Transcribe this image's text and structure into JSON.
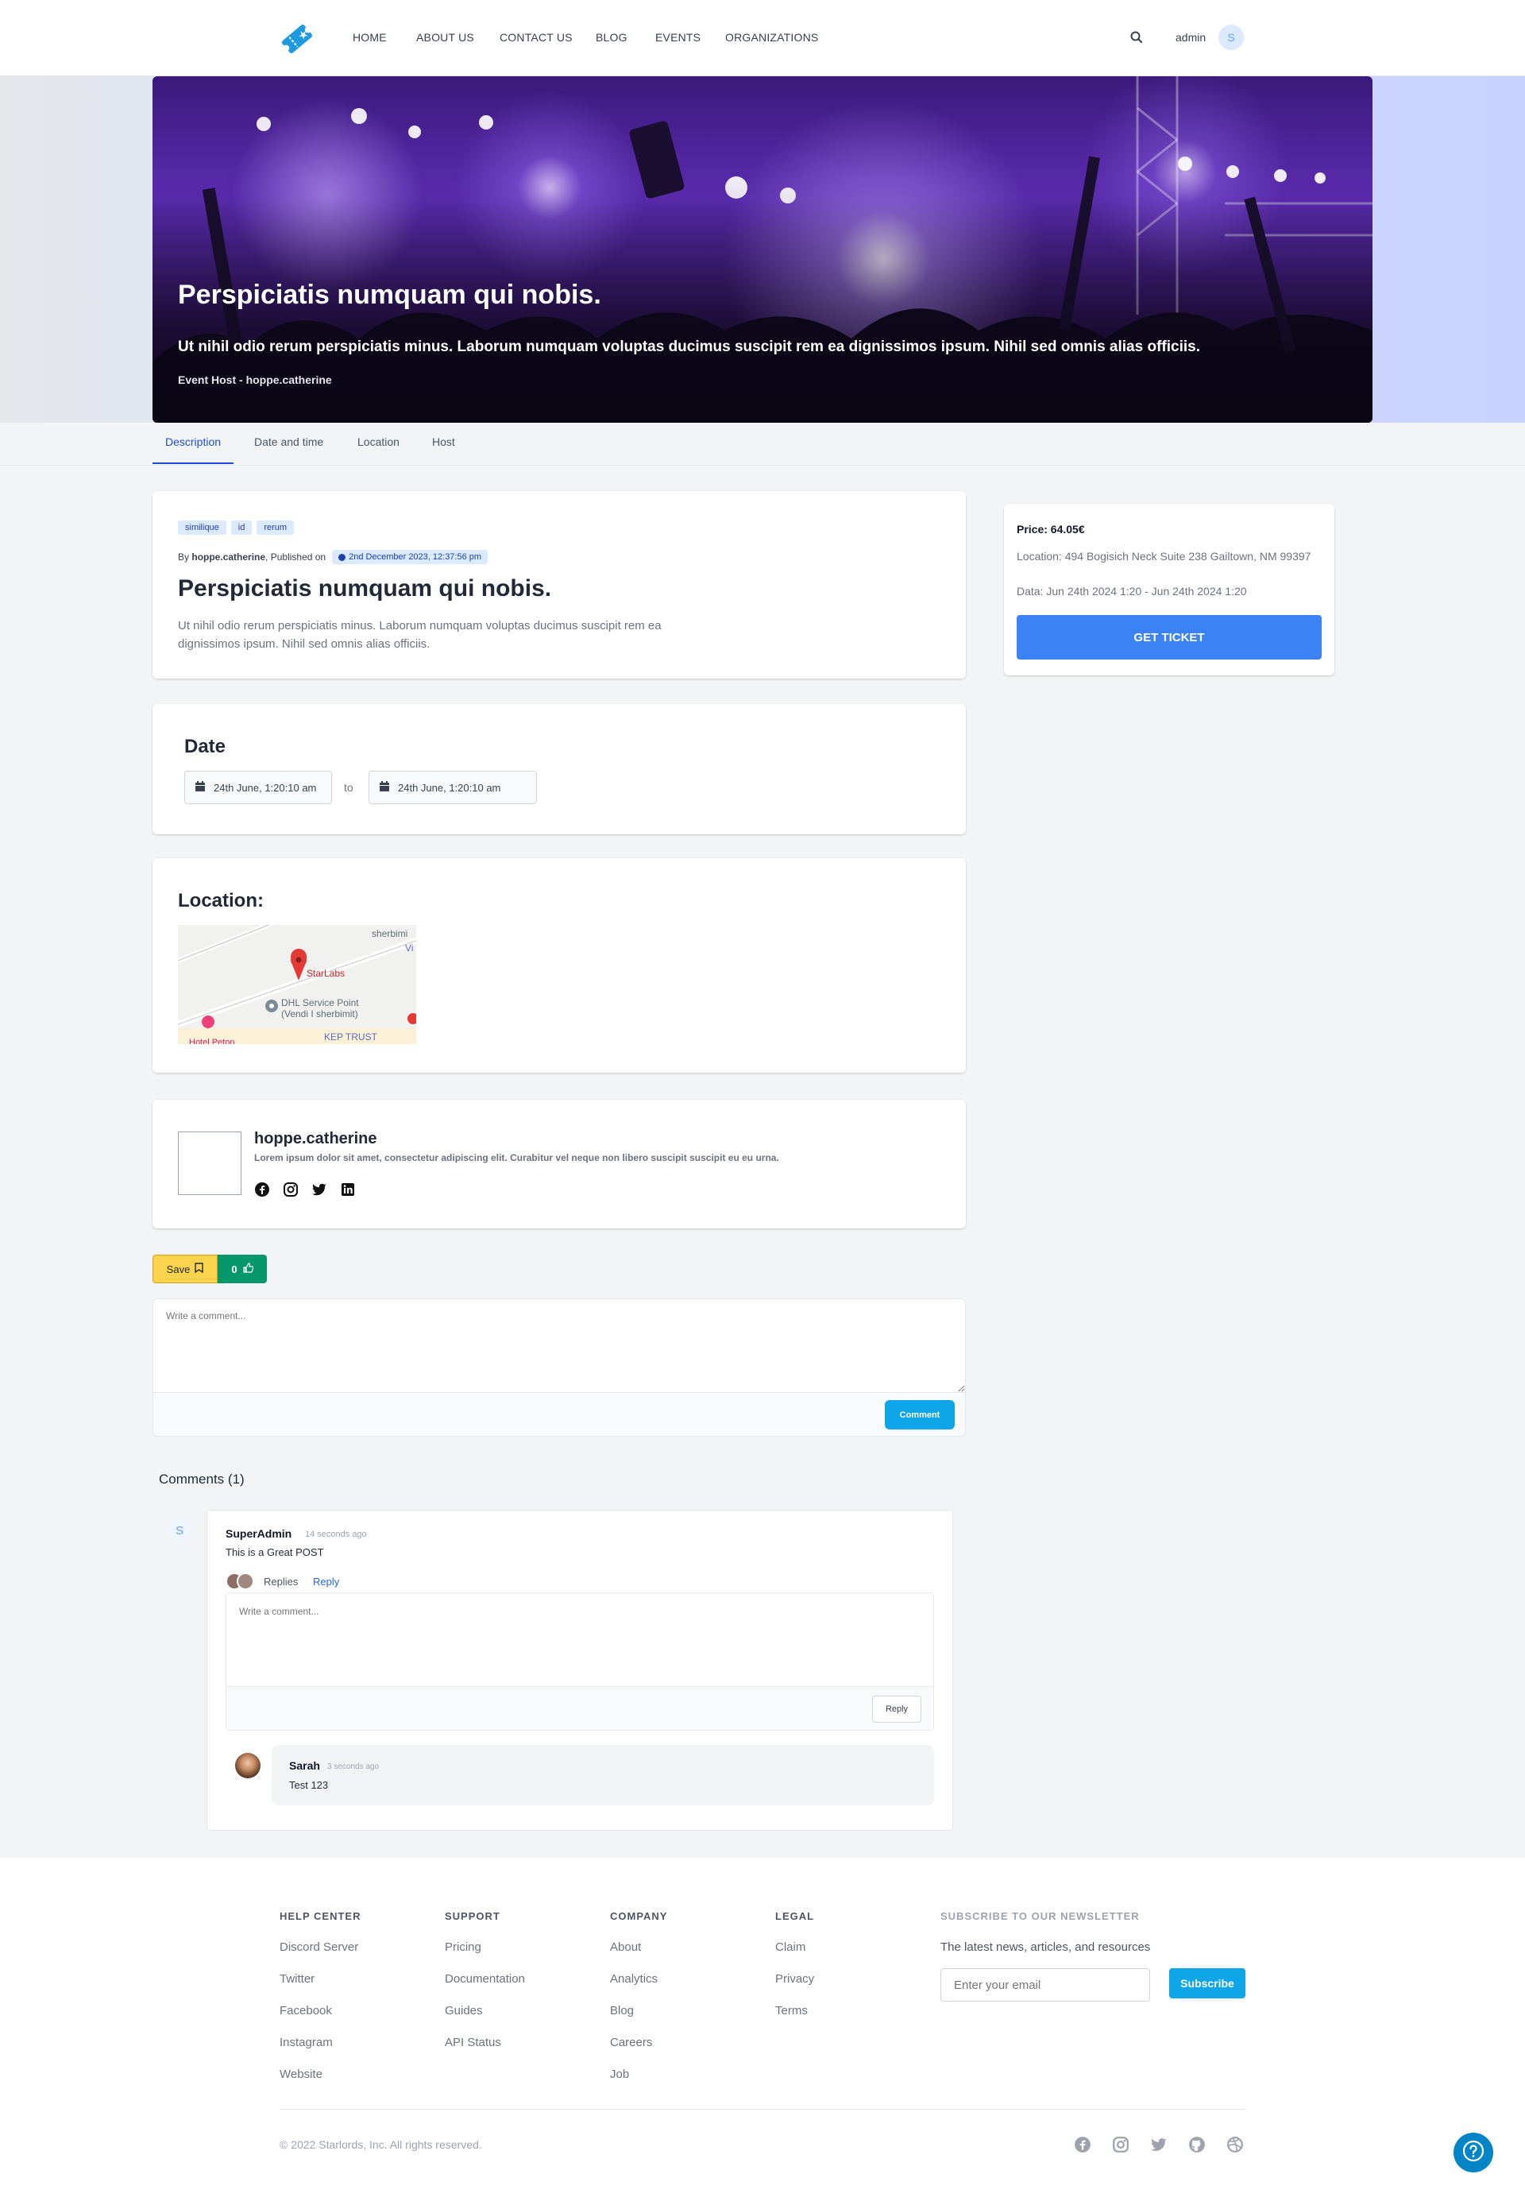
{
  "nav": {
    "links": [
      "HOME",
      "ABOUT US",
      "CONTACT US",
      "BLOG",
      "EVENTS",
      "ORGANIZATIONS"
    ],
    "user": "admin",
    "avatar_initial": "S"
  },
  "hero": {
    "title": "Perspiciatis numquam qui nobis.",
    "subtitle": "Ut nihil odio rerum perspiciatis minus. Laborum numquam voluptas ducimus suscipit rem ea dignissimos ipsum. Nihil sed omnis alias officiis.",
    "host": "Event Host - hoppe.catherine"
  },
  "tabs": [
    "Description",
    "Date and time",
    "Location",
    "Host"
  ],
  "description": {
    "tags": [
      "similique",
      "id",
      "rerum"
    ],
    "by_prefix": "By",
    "author": "hoppe.catherine",
    "published_label": ", Published on",
    "published_date": "2nd December 2023, 12:37:56 pm",
    "title": "Perspiciatis numquam qui nobis.",
    "body": "Ut nihil odio rerum perspiciatis minus. Laborum numquam voluptas ducimus suscipit rem ea dignissimos ipsum. Nihil sed omnis alias officiis."
  },
  "ticket": {
    "price": "Price: 64.05€",
    "location": "Location: 494 Bogisich Neck Suite 238 Gailtown, NM 99397",
    "data": "Data: Jun 24th 2024 1:20 - Jun 24th 2024 1:20",
    "button": "GET TICKET"
  },
  "date": {
    "heading": "Date",
    "start": "24th June, 1:20:10 am",
    "to": "to",
    "end": "24th June, 1:20:10 am"
  },
  "location": {
    "heading": "Location:",
    "map_labels": {
      "place": "StarLabs",
      "dhl": "DHL Service Point",
      "dhl2": "(Vendi I sherbimit)",
      "kep": "KEP TRUST",
      "hotel": "Hotel Peton",
      "top": "sherbimi",
      "top2": "Vi"
    }
  },
  "host": {
    "name": "hoppe.catherine",
    "bio": "Lorem ipsum dolor sit amet, consectetur adipiscing elit. Curabitur vel neque non libero suscipit suscipit eu eu urna."
  },
  "actions": {
    "save": "Save",
    "likes": "0"
  },
  "comment_box": {
    "placeholder": "Write a comment...",
    "button": "Comment"
  },
  "comments": {
    "heading": "Comments (1)",
    "items": [
      {
        "initial": "S",
        "author": "SuperAdmin",
        "time": "14 seconds ago",
        "text": "This is a Great POST",
        "replies_label": "Replies",
        "reply_label": "Reply",
        "reply_placeholder": "Write a comment...",
        "reply_button": "Reply",
        "replies": [
          {
            "author": "Sarah",
            "time": "3 seconds ago",
            "text": "Test 123"
          }
        ]
      }
    ]
  },
  "footer": {
    "columns": [
      {
        "title": "HELP CENTER",
        "links": [
          "Discord Server",
          "Twitter",
          "Facebook",
          "Instagram",
          "Website"
        ]
      },
      {
        "title": "SUPPORT",
        "links": [
          "Pricing",
          "Documentation",
          "Guides",
          "API Status"
        ]
      },
      {
        "title": "COMPANY",
        "links": [
          "About",
          "Analytics",
          "Blog",
          "Careers",
          "Job"
        ]
      },
      {
        "title": "LEGAL",
        "links": [
          "Claim",
          "Privacy",
          "Terms"
        ]
      }
    ],
    "newsletter": {
      "title": "SUBSCRIBE TO OUR NEWSLETTER",
      "text": "The latest news, articles, and resources",
      "placeholder": "Enter your email",
      "button": "Subscribe"
    },
    "copyright": "© 2022 Starlords, Inc. All rights reserved."
  }
}
